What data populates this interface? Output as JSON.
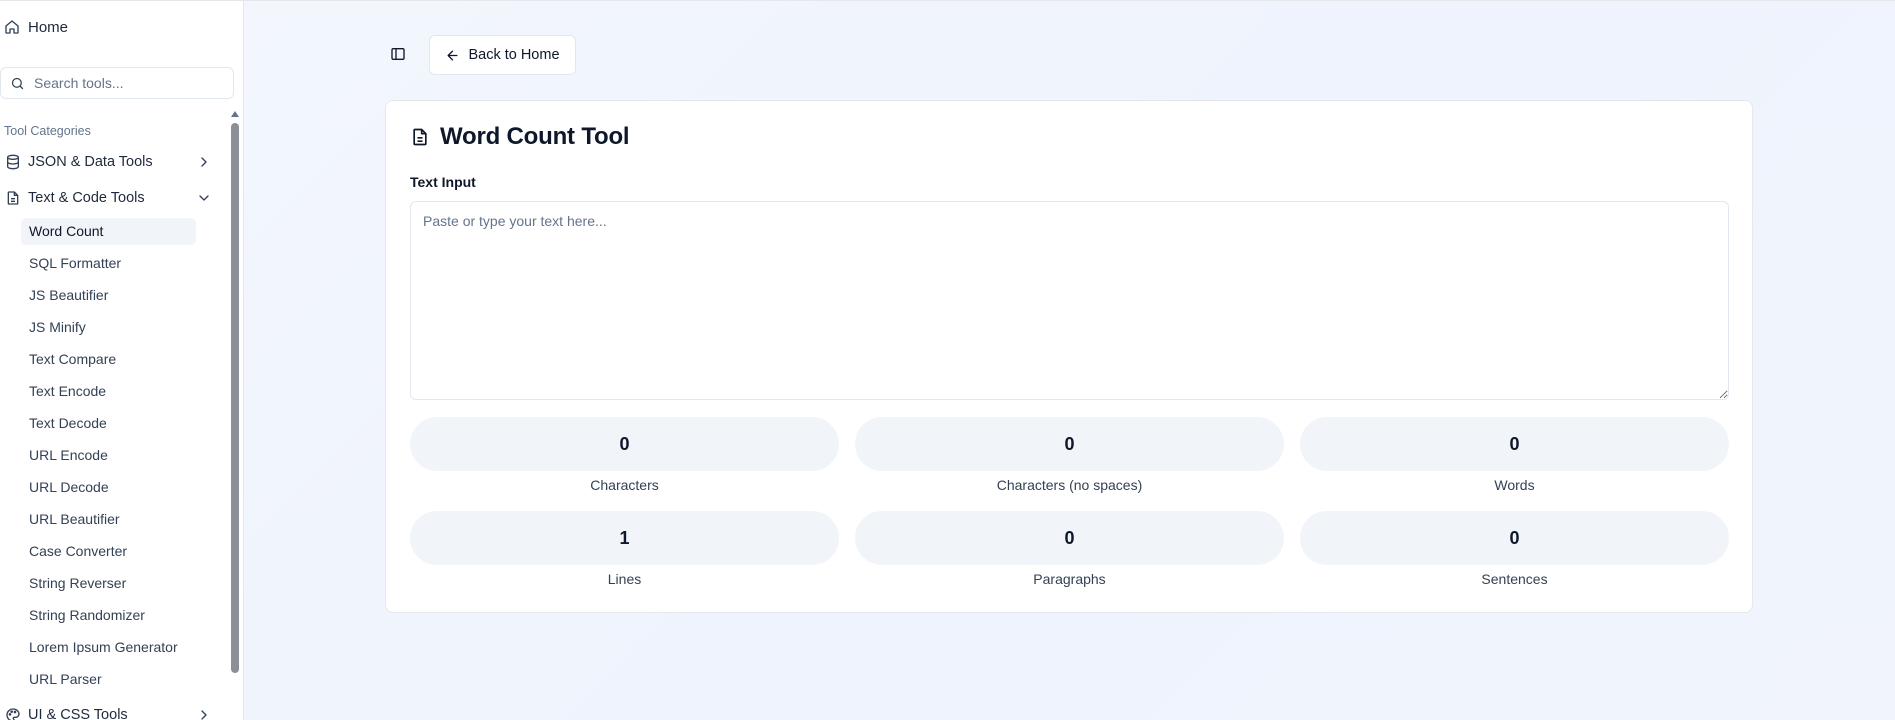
{
  "sidebar": {
    "home_label": "Home",
    "search": {
      "placeholder": "Search tools..."
    },
    "categories_heading": "Tool Categories",
    "categories": [
      {
        "label": "JSON & Data Tools",
        "icon": "database-icon",
        "expanded": false
      },
      {
        "label": "Text & Code Tools",
        "icon": "file-text-icon",
        "expanded": true
      },
      {
        "label": "UI & CSS Tools",
        "icon": "palette-icon",
        "expanded": false
      }
    ],
    "text_tools": [
      "Word Count",
      "SQL Formatter",
      "JS Beautifier",
      "JS Minify",
      "Text Compare",
      "Text Encode",
      "Text Decode",
      "URL Encode",
      "URL Decode",
      "URL Beautifier",
      "Case Converter",
      "String Reverser",
      "String Randomizer",
      "Lorem Ipsum Generator",
      "URL Parser"
    ],
    "active_tool": "Word Count"
  },
  "header": {
    "back_label": "Back to Home"
  },
  "tool": {
    "title": "Word Count Tool",
    "input_label": "Text Input",
    "input_placeholder": "Paste or type your text here...",
    "input_value": "",
    "stats": [
      {
        "value": "0",
        "label": "Characters"
      },
      {
        "value": "0",
        "label": "Characters (no spaces)"
      },
      {
        "value": "0",
        "label": "Words"
      },
      {
        "value": "1",
        "label": "Lines"
      },
      {
        "value": "0",
        "label": "Paragraphs"
      },
      {
        "value": "0",
        "label": "Sentences"
      }
    ]
  },
  "colors": {
    "accent_bg": "#f1f5f9",
    "text_primary": "#0f172a",
    "text_muted": "#64748b",
    "border": "#e2e8f0"
  }
}
